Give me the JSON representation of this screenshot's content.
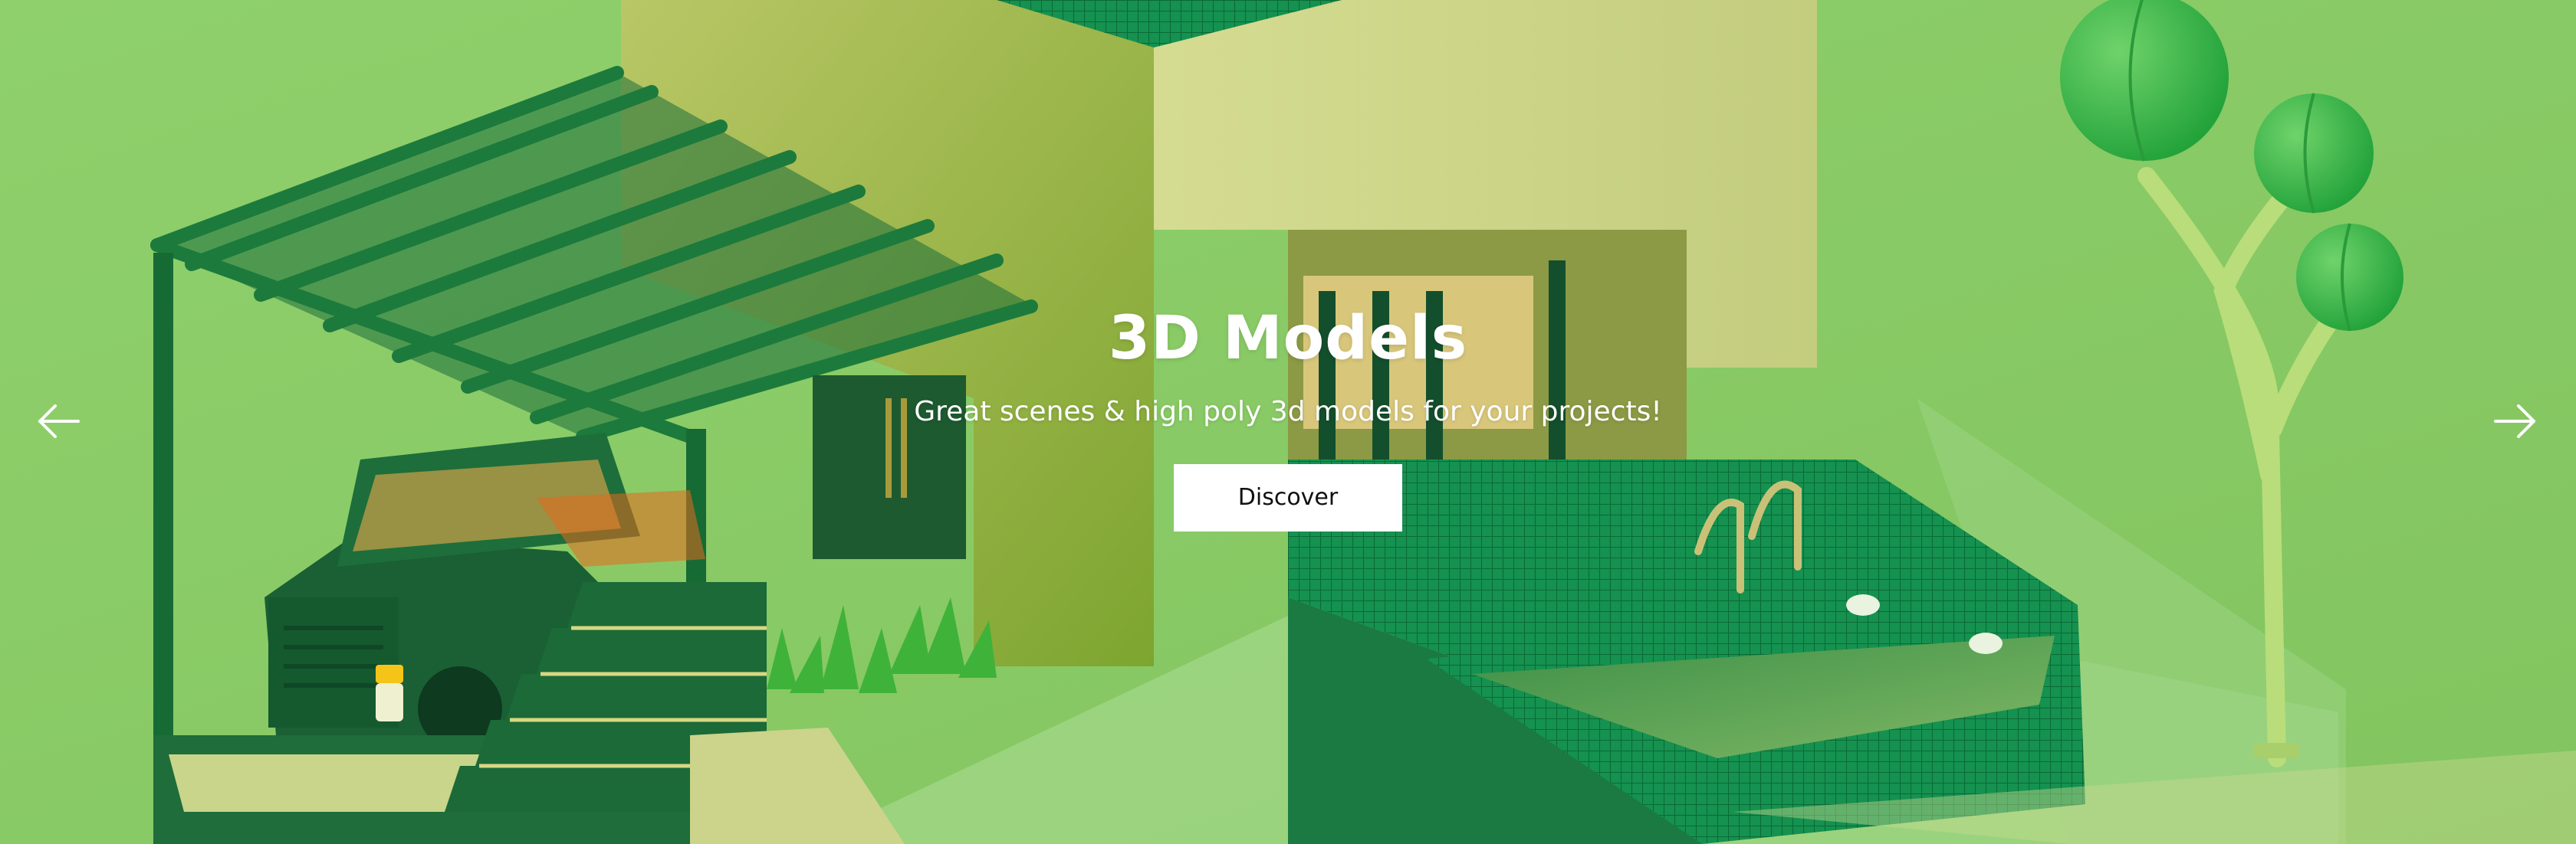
{
  "hero": {
    "title": "3D Models",
    "subtitle": "Great scenes & high poly 3d models for your projects!",
    "cta_label": "Discover",
    "background_image": "isometric-green-house-scene",
    "prev_icon": "arrow-left-icon",
    "next_icon": "arrow-right-icon"
  },
  "colors": {
    "background": "#8ccd6a",
    "dark_green": "#1d6b3a",
    "tile_green": "#17904f",
    "wall": "#c8d48a",
    "text": "#ffffff",
    "button_bg": "#ffffff",
    "button_text": "#111111"
  }
}
